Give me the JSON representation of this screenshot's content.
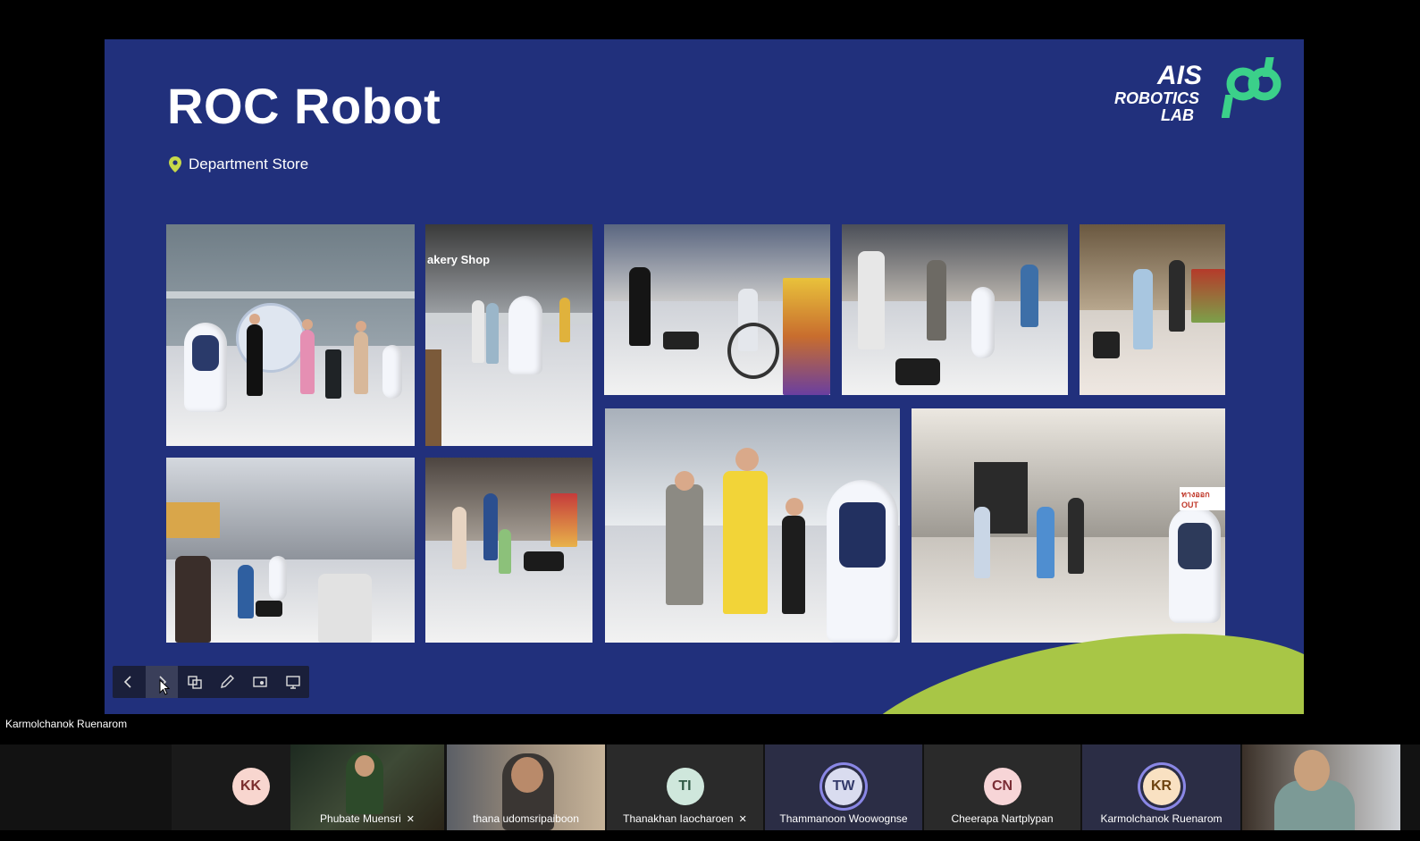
{
  "slide": {
    "title": "ROC Robot",
    "location": "Department Store",
    "logo": {
      "line1": "AIS",
      "line2": "ROBOTICS",
      "line3": "LAB",
      "color_accent": "#3bd08a"
    },
    "photo_captions": {
      "bakery_sign": "akery Shop",
      "exit_sign": "ทางออก OUT"
    }
  },
  "toolbar": {
    "buttons": [
      "previous",
      "next",
      "slides-overview",
      "pen",
      "laser",
      "present-settings"
    ]
  },
  "presenter": {
    "name": "Karmolchanok Ruenarom"
  },
  "participants": [
    {
      "initials": "KK",
      "name": "",
      "avatar_color": "#f8d6cf",
      "text_color": "#7a2d2d"
    },
    {
      "initials": "",
      "name": "Phubate Muensri",
      "muted": true
    },
    {
      "initials": "",
      "name": "thana udomsripaiboon",
      "muted": false
    },
    {
      "initials": "TI",
      "name": "Thanakhan Iaocharoen",
      "avatar_color": "#cfe7dc",
      "text_color": "#2f5a45",
      "muted": true
    },
    {
      "initials": "TW",
      "name": "Thammanoon Woowognse",
      "avatar_color": "#d9dcef",
      "text_color": "#333a6a",
      "active": true
    },
    {
      "initials": "CN",
      "name": "Cheerapa Nartplypan",
      "avatar_color": "#f7d5d7",
      "text_color": "#7a2d35"
    },
    {
      "initials": "KR",
      "name": "Karmolchanok Ruenarom",
      "avatar_color": "#f9e1c2",
      "text_color": "#6d4310",
      "active": true
    },
    {
      "initials": "",
      "name": ""
    }
  ],
  "colors": {
    "slide_bg": "#21307c",
    "accent_green": "#a8c646",
    "window_bg": "#000000"
  }
}
